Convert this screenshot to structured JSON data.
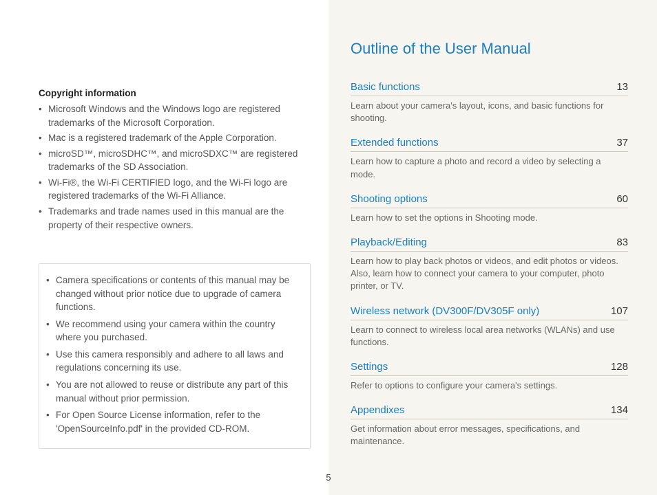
{
  "left": {
    "copyright_heading": "Copyright information",
    "copyright_items": [
      "Microsoft Windows and the Windows logo are registered trademarks of the Microsoft Corporation.",
      "Mac is a registered trademark of the Apple Corporation.",
      "microSD™, microSDHC™, and microSDXC™ are registered trademarks of the SD Association.",
      "Wi-Fi®, the Wi-Fi CERTIFIED logo, and the Wi-Fi logo are registered trademarks of the Wi-Fi Alliance.",
      "Trademarks and trade names used in this manual are the property of their respective owners."
    ],
    "note_items": [
      "Camera specifications or contents of this manual may be changed without prior notice due to upgrade of camera functions.",
      "We recommend using your camera within the country where you purchased.",
      "Use this camera responsibly and adhere to all laws and regulations concerning its use.",
      "You are not allowed to reuse or distribute any part of this manual without prior permission.",
      "For Open Source License information, refer to the 'OpenSourceInfo.pdf' in the provided CD-ROM."
    ]
  },
  "right": {
    "outline_title": "Outline of the User Manual",
    "entries": [
      {
        "title": "Basic functions",
        "page": "13",
        "desc": "Learn about your camera's layout, icons, and basic functions for shooting."
      },
      {
        "title": "Extended functions",
        "page": "37",
        "desc": "Learn how to capture a photo and record a video by selecting a mode."
      },
      {
        "title": "Shooting options",
        "page": "60",
        "desc": "Learn how to set the options in Shooting mode."
      },
      {
        "title": "Playback/Editing",
        "page": "83",
        "desc": "Learn how to play back photos or videos, and edit photos or videos. Also, learn how to connect your camera to your computer, photo printer, or TV."
      },
      {
        "title": "Wireless network (DV300F/DV305F only)",
        "page": "107",
        "desc": "Learn to connect to wireless local area networks (WLANs) and use functions."
      },
      {
        "title": "Settings",
        "page": "128",
        "desc": "Refer to options to configure your camera's settings."
      },
      {
        "title": "Appendixes",
        "page": "134",
        "desc": "Get information about error messages, specifications, and maintenance."
      }
    ]
  },
  "page_number": "5"
}
